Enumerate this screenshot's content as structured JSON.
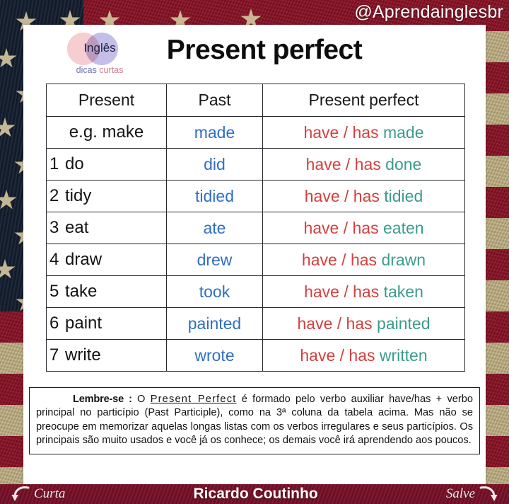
{
  "watermark": {
    "handle": "@Aprendainglesbr"
  },
  "logo": {
    "word": "Inglês",
    "sub_part1": "dicas ",
    "sub_part2": "curtas",
    "color_left": "#f6cdd0",
    "color_right": "#c3bfe8"
  },
  "title": "Present perfect",
  "table": {
    "headers": [
      "Present",
      "Past",
      "Present perfect"
    ],
    "colors": {
      "present": "#141414",
      "past": "#2f6ec4",
      "auxiliary": "#d2403f",
      "participle": "#3b9c8d"
    },
    "aux_label": "have / has",
    "rows": [
      {
        "num": "",
        "present": "e.g. make",
        "past": "made",
        "aux": "have / has",
        "participle": "made"
      },
      {
        "num": "1",
        "present": "do",
        "past": "did",
        "aux": "have / has",
        "participle": "done"
      },
      {
        "num": "2",
        "present": "tidy",
        "past": "tidied",
        "aux": "have / has",
        "participle": "tidied"
      },
      {
        "num": "3",
        "present": "eat",
        "past": "ate",
        "aux": "have / has",
        "participle": "eaten"
      },
      {
        "num": "4",
        "present": "draw",
        "past": "drew",
        "aux": "have / has",
        "participle": "drawn"
      },
      {
        "num": "5",
        "present": "take",
        "past": "took",
        "aux": "have / has",
        "participle": "taken"
      },
      {
        "num": "6",
        "present": "paint",
        "past": "painted",
        "aux": "have / has",
        "participle": "painted"
      },
      {
        "num": "7",
        "present": "write",
        "past": "wrote",
        "aux": "have / has",
        "participle": "written"
      }
    ]
  },
  "note": {
    "label": "Lembre-se :",
    "before_link": " O ",
    "link": "Present Perfect",
    "after_link": " é formado pelo verbo auxiliar have/has + verbo principal no particípio (Past Participle), como na 3ª coluna da tabela acima. Mas não se preocupe em memorizar aquelas longas listas com os verbos irregulares e seus particípios. Os principais são muito usados e você já os conhece; os demais você irá aprendendo aos poucos."
  },
  "footer": {
    "left_label": "Curta",
    "center_label": "Ricardo Coutinho",
    "right_label": "Salve",
    "background": "#7d1128"
  },
  "flag": {
    "stripe_red": "#8d1226",
    "stripe_cream": "#c6b78a",
    "canton_navy": "#141f30",
    "star_color": "#cdc09a"
  }
}
